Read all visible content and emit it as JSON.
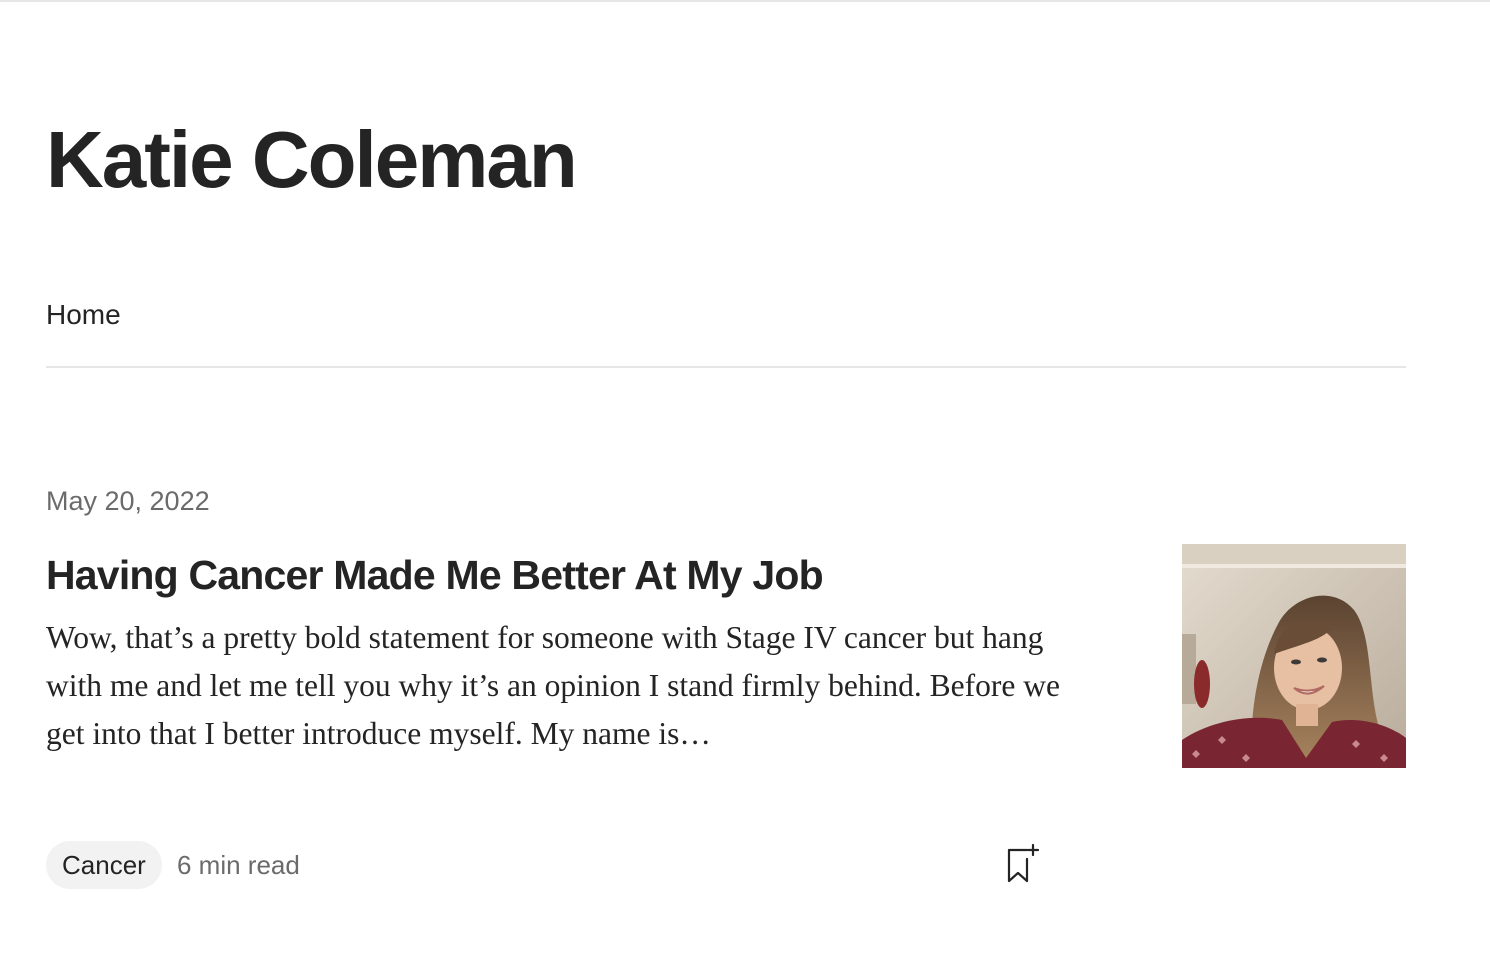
{
  "author": {
    "name": "Katie Coleman"
  },
  "nav": {
    "tabs": [
      {
        "label": "Home",
        "active": true
      }
    ]
  },
  "post": {
    "date": "May 20, 2022",
    "title": "Having Cancer Made Me Better At My Job",
    "excerpt": "Wow, that’s a pretty bold statement for someone with Stage IV cancer but hang with me and let me tell you why it’s an opinion I stand firmly behind. Before we get into that I better introduce myself. My name is…",
    "tag": "Cancer",
    "read_time": "6 min read",
    "thumbnail": {
      "alt": "Katie Coleman"
    },
    "save_icon": "bookmark-add-icon"
  },
  "colors": {
    "text": "#242424",
    "muted": "#6b6b6b",
    "divider": "#e6e6e6",
    "pill": "#f2f2f2"
  }
}
